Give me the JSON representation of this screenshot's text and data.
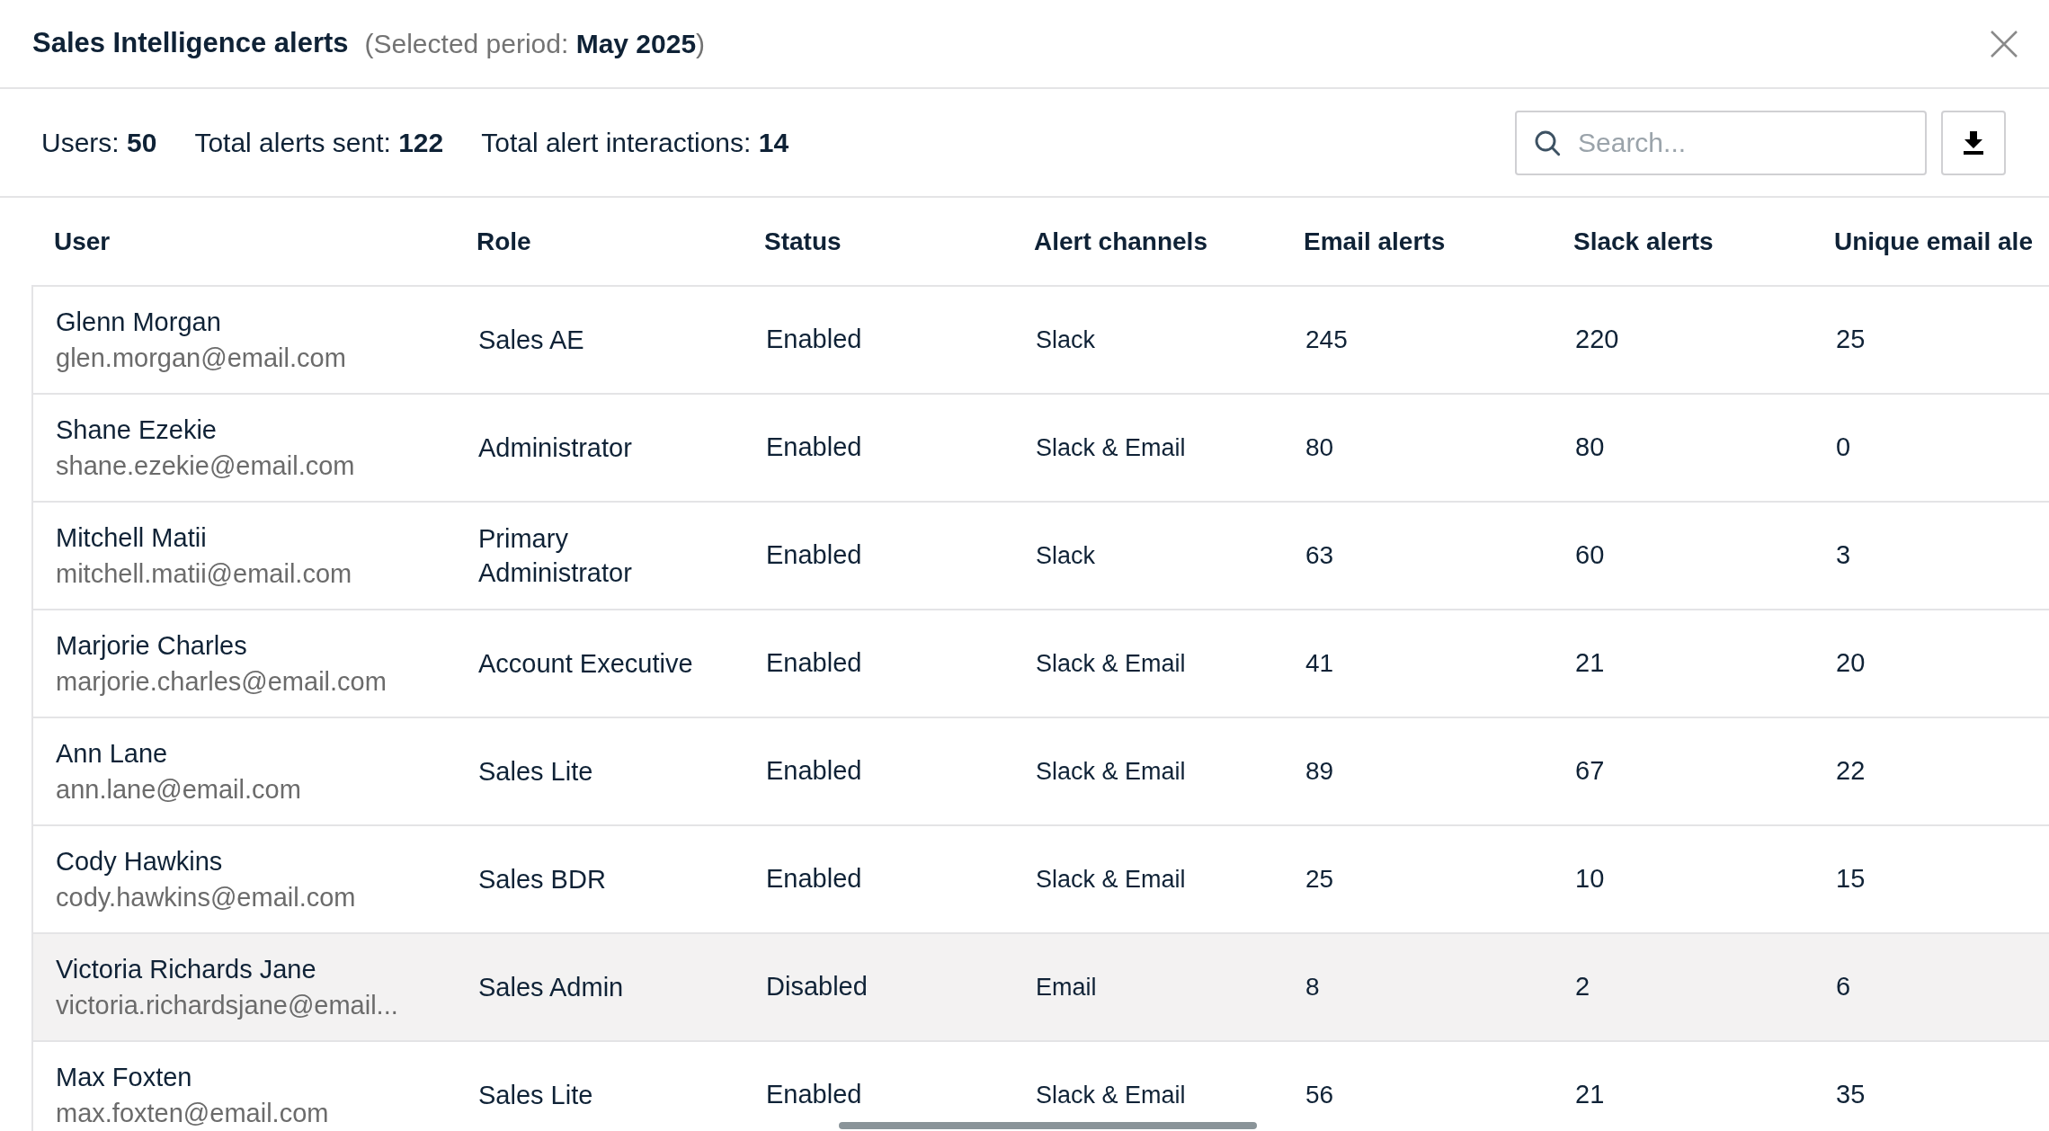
{
  "header": {
    "title": "Sales Intelligence alerts",
    "subtitle": "(Selected period: **May 2025**)"
  },
  "stats": [
    "Users: **50**",
    "Total alerts sent: **122**",
    "Total alert interactions: **14**"
  ],
  "search": {
    "placeholder": "Search..."
  },
  "table": {
    "columns": [
      "User",
      "Role",
      "Status",
      "Alert channels",
      "Email alerts",
      "Slack alerts",
      "Unique email ale"
    ],
    "rows": [
      {
        "name": "Glenn Morgan",
        "email": "glen.morgan@email.com",
        "role": "Sales AE",
        "status": "Enabled",
        "channels": "Slack",
        "email_alerts": "245",
        "slack_alerts": "220",
        "unique": "25",
        "selected": false
      },
      {
        "name": "Shane Ezekie",
        "email": "shane.ezekie@email.com",
        "role": "Administrator",
        "status": "Enabled",
        "channels": "Slack & Email",
        "email_alerts": "80",
        "slack_alerts": "80",
        "unique": "0",
        "selected": false
      },
      {
        "name": "Mitchell Matii",
        "email": "mitchell.matii@email.com",
        "role": "Primary Administrator",
        "status": "Enabled",
        "channels": "Slack",
        "email_alerts": "63",
        "slack_alerts": "60",
        "unique": "3",
        "selected": false
      },
      {
        "name": "Marjorie Charles",
        "email": "marjorie.charles@email.com",
        "role": "Account Executive",
        "status": "Enabled",
        "channels": "Slack & Email",
        "email_alerts": "41",
        "slack_alerts": "21",
        "unique": "20",
        "selected": false
      },
      {
        "name": "Ann Lane",
        "email": "ann.lane@email.com",
        "role": "Sales Lite",
        "status": "Enabled",
        "channels": "Slack & Email",
        "email_alerts": "89",
        "slack_alerts": "67",
        "unique": "22",
        "selected": false
      },
      {
        "name": "Cody Hawkins",
        "email": "cody.hawkins@email.com",
        "role": "Sales BDR",
        "status": "Enabled",
        "channels": "Slack & Email",
        "email_alerts": "25",
        "slack_alerts": "10",
        "unique": "15",
        "selected": false
      },
      {
        "name": "Victoria Richards Jane",
        "email": "victoria.richardsjane@email...",
        "role": "Sales Admin",
        "status": "Disabled",
        "channels": "Email",
        "email_alerts": "8",
        "slack_alerts": "2",
        "unique": "6",
        "selected": true
      },
      {
        "name": "Max Foxten",
        "email": "max.foxten@email.com",
        "role": "Sales Lite",
        "status": "Enabled",
        "channels": "Slack & Email",
        "email_alerts": "56",
        "slack_alerts": "21",
        "unique": "35",
        "selected": false
      }
    ]
  }
}
